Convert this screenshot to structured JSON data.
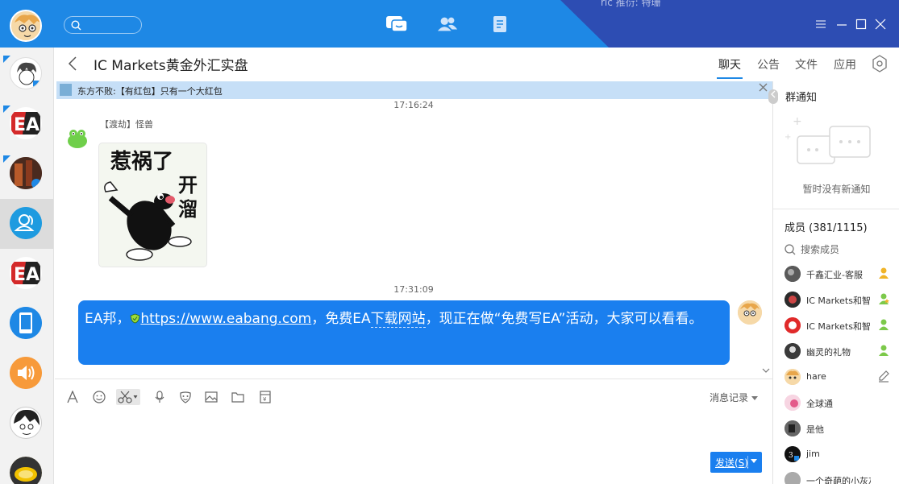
{
  "titlebar": {
    "search_placeholder": "",
    "tabs": [
      {
        "name": "messages",
        "icon": "chat-bubbles-icon",
        "active": true
      },
      {
        "name": "contacts",
        "icon": "contacts-icon",
        "active": false
      },
      {
        "name": "docs",
        "icon": "document-icon",
        "active": false
      }
    ],
    "ghost_text": "ric 推衍: 特珊",
    "window_controls": [
      "menu-icon",
      "minimize-icon",
      "maximize-icon",
      "close-icon"
    ]
  },
  "sessions": [
    {
      "name": "session-manga",
      "badge": true
    },
    {
      "name": "session-ea-logo",
      "badge": true
    },
    {
      "name": "session-photo",
      "badge": true
    },
    {
      "name": "session-group",
      "active": true
    },
    {
      "name": "session-ea-logo-2"
    },
    {
      "name": "session-phone"
    },
    {
      "name": "session-speaker"
    },
    {
      "name": "session-anime"
    },
    {
      "name": "session-lemon"
    }
  ],
  "header": {
    "title": "IC Markets黄金外汇实盘",
    "tabs": [
      "聊天",
      "公告",
      "文件",
      "应用"
    ],
    "active_tab": "聊天"
  },
  "notice_bar": {
    "text": "东方不败:【有红包】只有一个大红包"
  },
  "chat": {
    "messages": [
      {
        "time": "17:16:24",
        "sender": "【渡劫】怪兽",
        "type": "sticker",
        "sticker_text": [
          "惹祸了",
          "开",
          "溜"
        ]
      },
      {
        "time": "17:31:09",
        "type": "text",
        "self": true,
        "parts": {
          "prefix": "EA邦，",
          "link": "https://www.eabang.com",
          "middle": "，免费EA",
          "dashed": "下载网站",
          "suffix": "，现正在做“免费写EA”活动，大家可以看看。"
        }
      }
    ]
  },
  "input": {
    "tools": [
      "font-icon",
      "emoji-icon",
      "scissors-icon",
      "mic-icon",
      "mask-icon",
      "image-icon",
      "folder-icon",
      "red-envelope-icon"
    ],
    "history_label": "消息记录",
    "send_label": "发送(S)"
  },
  "right_panel": {
    "notice_title": "群通知",
    "notice_empty": "暂时没有新通知",
    "members_title": "成员 (381/1115)",
    "member_search": "搜索成员",
    "members": [
      {
        "name": "千鑫汇业-客服",
        "badge": "owner-icon"
      },
      {
        "name": "IC Markets和智",
        "badge": "admin-star-icon"
      },
      {
        "name": "IC Markets和智",
        "badge": "admin-icon"
      },
      {
        "name": "幽灵的礼物",
        "badge": "admin-icon"
      },
      {
        "name": "hare",
        "badge": "edit-icon"
      },
      {
        "name": "全球通",
        "badge": ""
      },
      {
        "name": "是他",
        "badge": ""
      },
      {
        "name": "jim",
        "badge": ""
      },
      {
        "name": "一个奇葩的小灰灰",
        "badge": ""
      }
    ]
  },
  "colors": {
    "accent": "#1e88e5",
    "bubble": "#1a7fef",
    "notice_bg": "#c6dff7",
    "titlebar_dark": "#2d4db3"
  }
}
